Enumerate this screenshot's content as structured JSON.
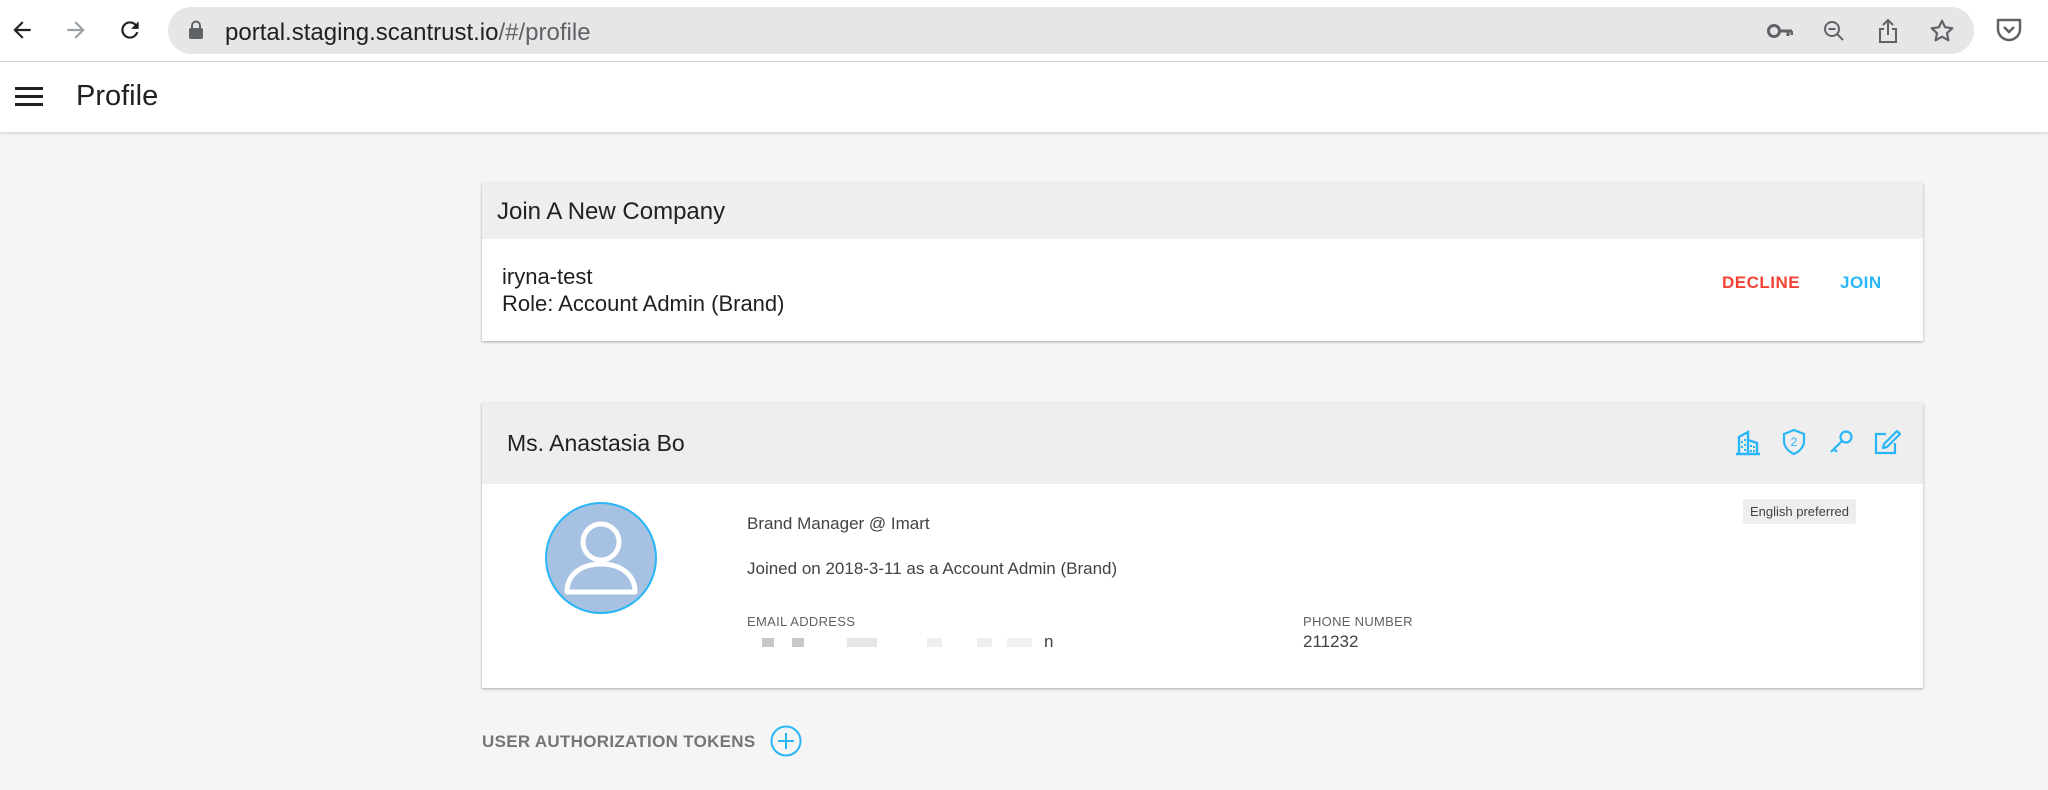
{
  "browser": {
    "url_host": "portal.staging.scantrust.io",
    "url_path": "/#/profile"
  },
  "header": {
    "title": "Profile"
  },
  "join_company": {
    "title": "Join A New Company",
    "company_name": "iryna-test",
    "role": "Role: Account Admin (Brand)",
    "decline_label": "DECLINE",
    "join_label": "JOIN"
  },
  "profile": {
    "name": "Ms. Anastasia Bo",
    "job_title": "Brand Manager @ Imart",
    "joined": "Joined on 2018-3-11 as a Account Admin (Brand)",
    "email_label": "EMAIL ADDRESS",
    "email_value_tail": "n",
    "phone_label": "PHONE NUMBER",
    "phone_value": "211232",
    "language_badge": "English preferred",
    "header_icons": [
      "building-icon",
      "two-factor-shield-icon",
      "key-icon",
      "edit-icon"
    ],
    "shield_number": "2"
  },
  "tokens": {
    "label": "USER AUTHORIZATION TOKENS"
  },
  "colors": {
    "accent": "#29b6f6",
    "decline": "#f44336",
    "avatar_bg": "#a7c1e2",
    "header_bg": "#eeeeee",
    "page_bg": "#f5f5f5"
  }
}
